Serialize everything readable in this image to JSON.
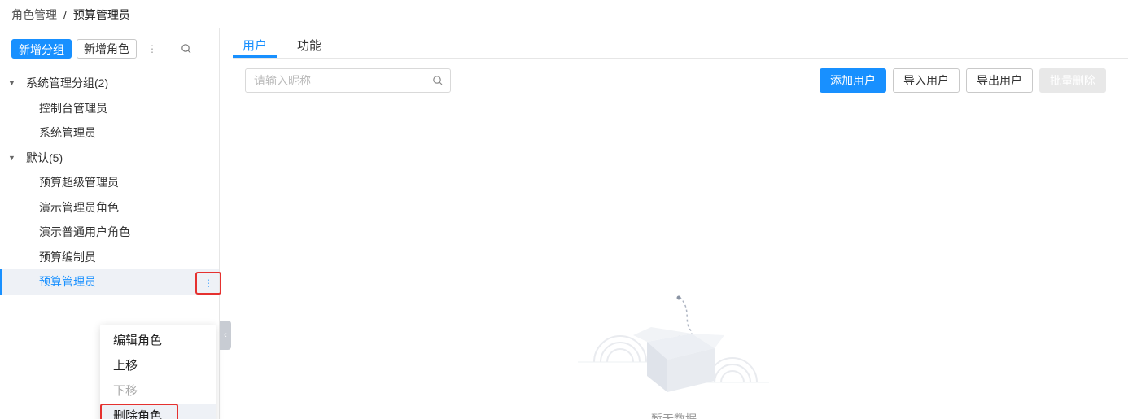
{
  "breadcrumb": {
    "parent": "角色管理",
    "separator": "/",
    "current": "预算管理员"
  },
  "left": {
    "new_group": "新增分组",
    "new_role": "新增角色",
    "tree": [
      {
        "type": "group",
        "label": "系统管理分组(2)"
      },
      {
        "type": "leaf",
        "label": "控制台管理员"
      },
      {
        "type": "leaf",
        "label": "系统管理员"
      },
      {
        "type": "group",
        "label": "默认(5)"
      },
      {
        "type": "leaf",
        "label": "预算超级管理员"
      },
      {
        "type": "leaf",
        "label": "演示管理员角色"
      },
      {
        "type": "leaf",
        "label": "演示普通用户角色"
      },
      {
        "type": "leaf",
        "label": "预算编制员"
      },
      {
        "type": "leaf",
        "label": "预算管理员",
        "active": true
      }
    ],
    "context_menu": {
      "edit": "编辑角色",
      "move_up": "上移",
      "move_down": "下移",
      "delete": "删除角色"
    }
  },
  "tabs": {
    "users": "用户",
    "functions": "功能"
  },
  "search": {
    "placeholder": "请输入昵称",
    "value": ""
  },
  "actions": {
    "add": "添加用户",
    "import": "导入用户",
    "export": "导出用户",
    "batch_delete": "批量删除"
  },
  "empty": {
    "text": "暂无数据"
  },
  "colors": {
    "primary": "#1890ff",
    "highlight": "#e5312f"
  }
}
